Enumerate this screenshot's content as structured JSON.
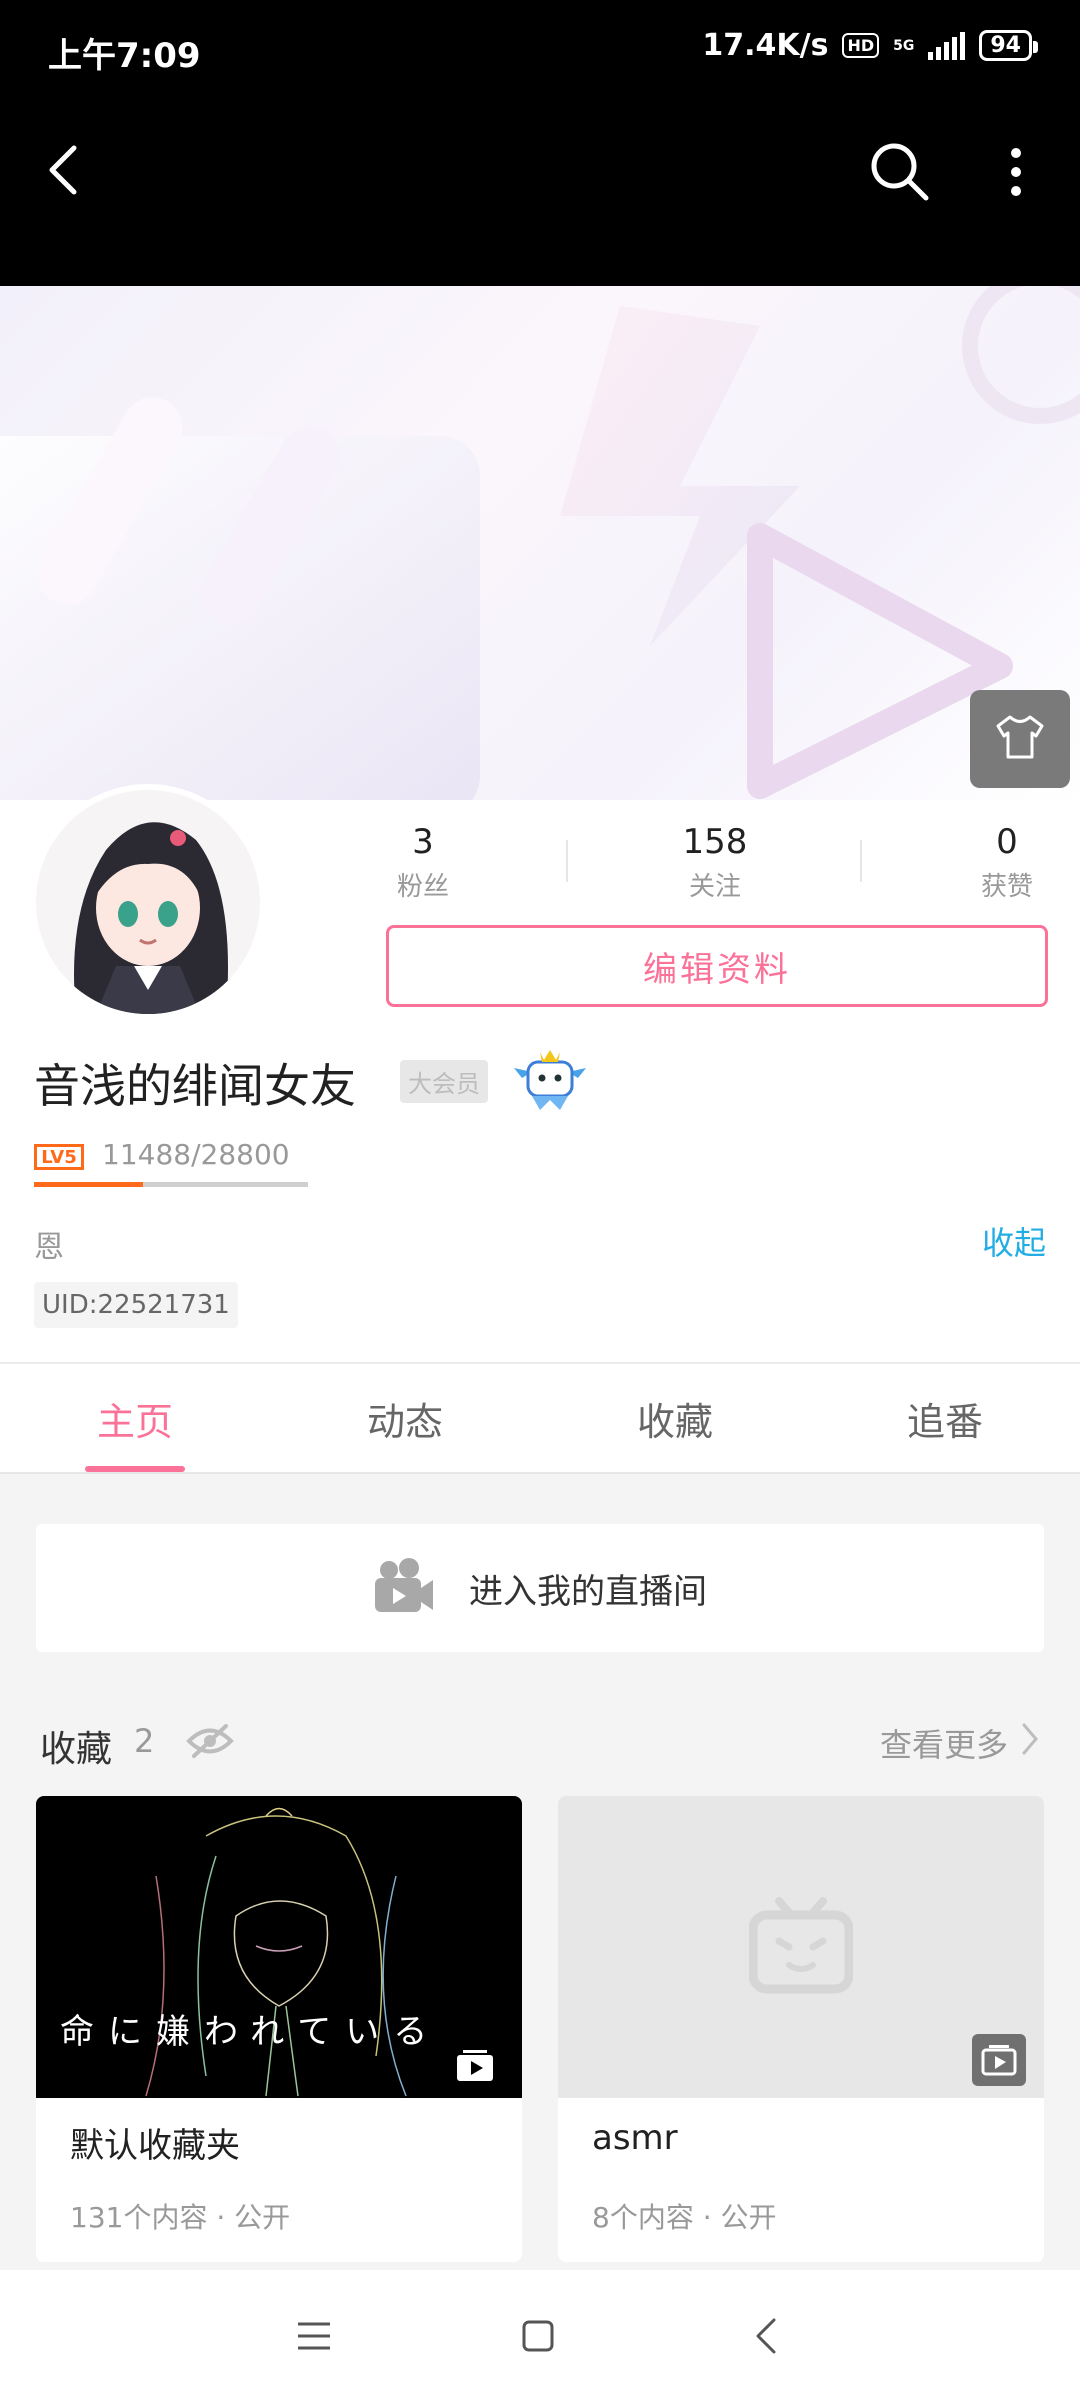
{
  "status_bar": {
    "time": "上午7:09",
    "net_speed": "17.4K/s",
    "hd": "HD",
    "network": "5G",
    "battery": "94"
  },
  "profile": {
    "stats": [
      {
        "num": "3",
        "label": "粉丝"
      },
      {
        "num": "158",
        "label": "关注"
      },
      {
        "num": "0",
        "label": "获赞"
      }
    ],
    "edit_label": "编辑资料",
    "username": "音浅的绯闻女友",
    "vip_label": "大会员",
    "level": "LV5",
    "exp": "11488/28800",
    "exp_fraction": 0.399,
    "sign": "恩",
    "collapse_label": "收起",
    "uid": "UID:22521731"
  },
  "tabs": [
    {
      "label": "主页",
      "active": true
    },
    {
      "label": "动态",
      "active": false
    },
    {
      "label": "收藏",
      "active": false
    },
    {
      "label": "追番",
      "active": false
    }
  ],
  "live_label": "进入我的直播间",
  "favorites": {
    "title": "收藏",
    "count": "2",
    "see_more": "查看更多",
    "cards": [
      {
        "title": "默认收藏夹",
        "meta": "131个内容 · 公开",
        "overlay_text": "命に嫌われている"
      },
      {
        "title": "asmr",
        "meta": "8个内容 · 公开"
      }
    ]
  },
  "colors": {
    "accent": "#fb7299",
    "link": "#23ade5",
    "level": "#ff6a1a"
  },
  "icons": [
    "back-icon",
    "search-icon",
    "more-icon",
    "shirt-icon",
    "camera-icon",
    "eye-off-icon",
    "chevron-right-icon",
    "play-icon",
    "tv-placeholder-icon",
    "menu-icon",
    "home-icon",
    "nav-back-icon"
  ]
}
